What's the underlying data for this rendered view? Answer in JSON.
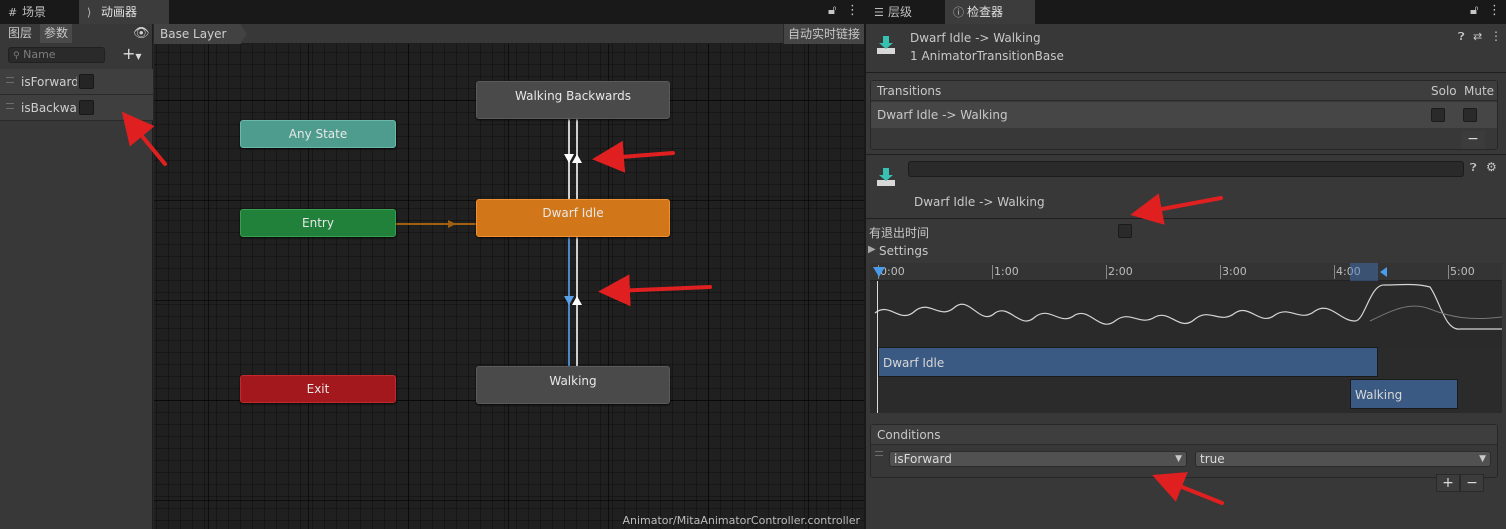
{
  "left_window": {
    "tabs": [
      {
        "label": "场景",
        "icon": "grid-icon"
      },
      {
        "label": "动画器",
        "icon": "animator-icon"
      }
    ],
    "params_panel": {
      "subtabs": [
        "图层",
        "参数"
      ],
      "search_placeholder": "Name",
      "add_label": "+",
      "params": [
        {
          "name": "isForward",
          "checked": false
        },
        {
          "name": "isBackward",
          "checked": false
        }
      ]
    },
    "breadcrumb": "Base Layer",
    "live_link_label": "自动实时链接",
    "nodes": {
      "walking_backwards": "Walking Backwards",
      "any_state": "Any State",
      "entry": "Entry",
      "dwarf_idle": "Dwarf Idle",
      "exit": "Exit",
      "walking": "Walking"
    },
    "status_path": "Animator/MitaAnimatorController.controller"
  },
  "right_window": {
    "tabs": [
      {
        "label": "层级",
        "icon": "hierarchy-icon"
      },
      {
        "label": "检查器",
        "icon": "info-icon"
      }
    ],
    "header": {
      "title": "Dwarf Idle -> Walking",
      "subtitle": "1 AnimatorTransitionBase"
    },
    "transitions": {
      "header": "Transitions",
      "solo_label": "Solo",
      "mute_label": "Mute",
      "items": [
        {
          "label": "Dwarf Idle -> Walking",
          "solo": false,
          "mute": false
        }
      ],
      "remove_label": "−"
    },
    "transition_detail": {
      "name_field": "",
      "label": "Dwarf Idle -> Walking",
      "has_exit_time_label": "有退出时间",
      "has_exit_time": false,
      "settings_label": "Settings"
    },
    "timeline": {
      "ticks": [
        "0:00",
        "1:00",
        "2:00",
        "3:00",
        "4:00",
        "5:00"
      ],
      "bars": [
        "Dwarf Idle",
        "Walking"
      ]
    },
    "conditions": {
      "header": "Conditions",
      "items": [
        {
          "parameter": "isForward",
          "value": "true"
        }
      ],
      "add_label": "+",
      "remove_label": "−"
    }
  },
  "colors": {
    "accent_orange": "#d2761a",
    "any_state": "#4d9c8d",
    "entry": "#21803a",
    "exit": "#a3181c",
    "annotation_arrow": "#e02020",
    "timeline_bar": "#3a5a84"
  }
}
